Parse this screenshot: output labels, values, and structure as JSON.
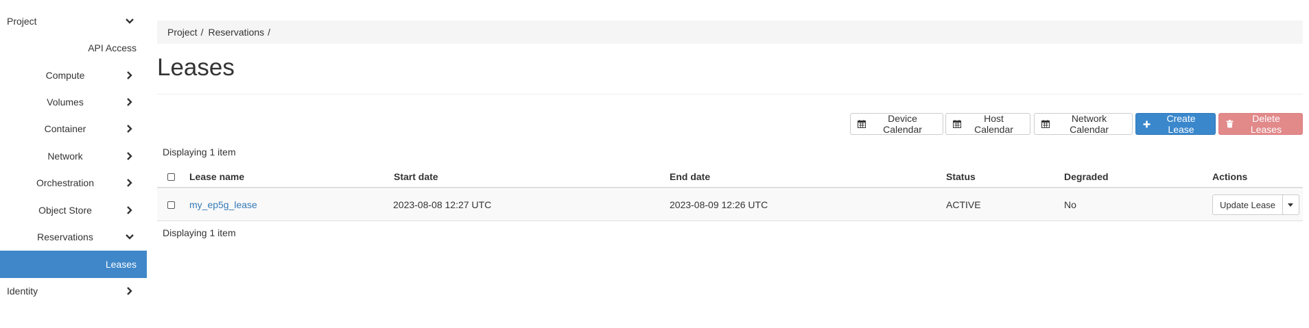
{
  "sidebar": {
    "project": "Project",
    "api_access": "API Access",
    "compute": "Compute",
    "volumes": "Volumes",
    "container": "Container",
    "network": "Network",
    "orchestration": "Orchestration",
    "object_store": "Object Store",
    "reservations": "Reservations",
    "leases": "Leases",
    "identity": "Identity"
  },
  "breadcrumb": {
    "items": [
      "Project",
      "Reservations"
    ],
    "separator": "/"
  },
  "page": {
    "title": "Leases"
  },
  "toolbar": {
    "device_calendar": "Device Calendar",
    "host_calendar": "Host Calendar",
    "network_calendar": "Network Calendar",
    "create_lease": "Create Lease",
    "delete_leases": "Delete Leases"
  },
  "table": {
    "count_top": "Displaying 1 item",
    "count_bottom": "Displaying 1 item",
    "columns": [
      "Lease name",
      "Start date",
      "End date",
      "Status",
      "Degraded",
      "Actions"
    ],
    "rows": [
      {
        "lease_name": "my_ep5g_lease",
        "start_date": "2023-08-08 12:27 UTC",
        "end_date": "2023-08-09 12:26 UTC",
        "status": "ACTIVE",
        "degraded": "No",
        "action": "Update Lease"
      }
    ]
  },
  "colors": {
    "active_nav": "#3f87c9",
    "primary": "#3a87cc",
    "danger": "#e2898a",
    "link": "#337ab7"
  }
}
